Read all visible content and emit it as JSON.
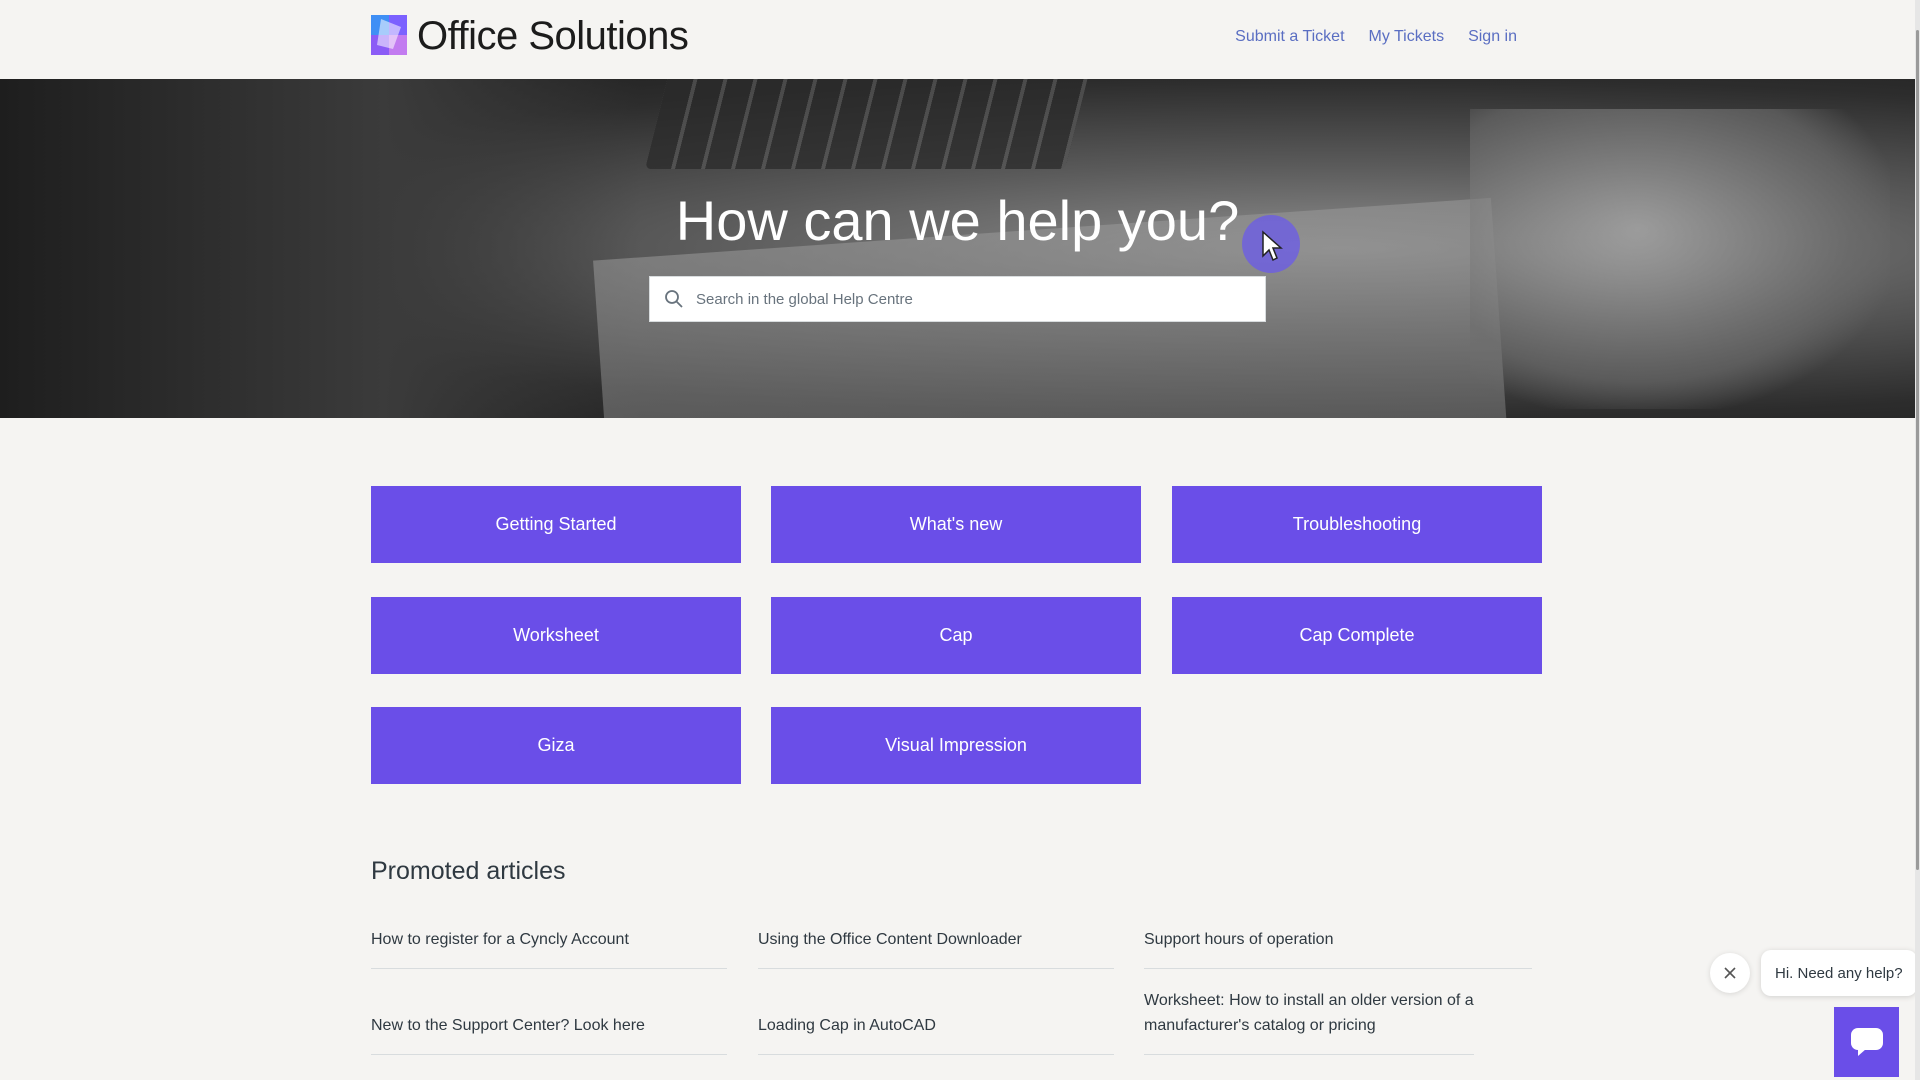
{
  "header": {
    "brand": "Office Solutions",
    "nav": [
      "Submit a Ticket",
      "My Tickets",
      "Sign in"
    ]
  },
  "hero": {
    "title": "How can we help you?",
    "search_placeholder": "Search in the global Help Centre"
  },
  "categories": [
    "Getting Started",
    "What's new",
    "Troubleshooting",
    "Worksheet",
    "Cap",
    "Cap Complete",
    "Giza",
    "Visual Impression"
  ],
  "promoted": {
    "title": "Promoted articles",
    "articles": [
      "How to register for a Cyncly Account",
      "Using the Office Content Downloader",
      "Support hours of operation",
      "New to the Support Center? Look here",
      "Loading Cap in AutoCAD",
      "Worksheet: How to install an older version of a manufacturer's catalog or pricing"
    ]
  },
  "chat": {
    "prompt": "Hi. Need any help?"
  },
  "colors": {
    "accent": "#6a4ee8",
    "link": "#5a6ec2",
    "text": "#2f3941",
    "background": "#f5f4f2"
  }
}
